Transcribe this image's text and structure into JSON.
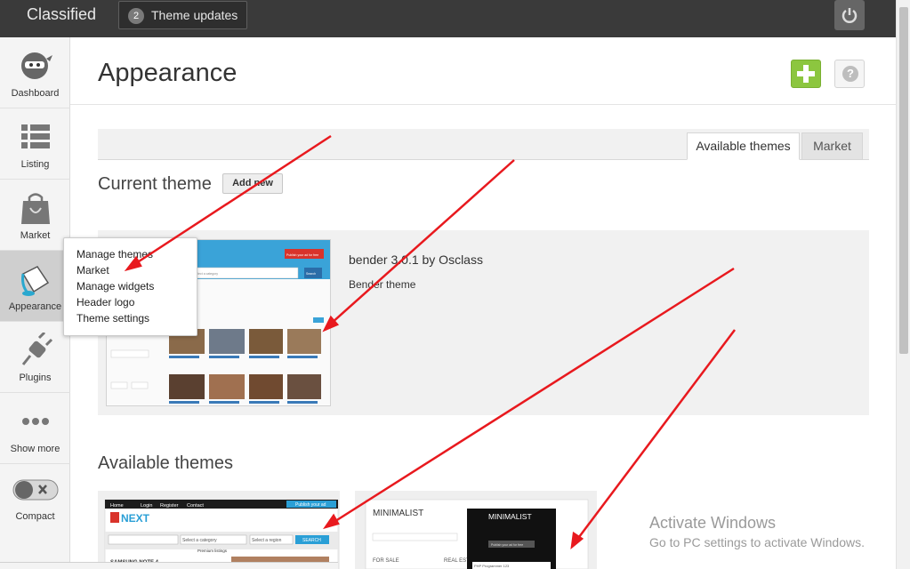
{
  "topbar": {
    "brand": "Classified",
    "updates_count": "2",
    "updates_label": "Theme updates"
  },
  "sidebar": {
    "items": [
      {
        "label": "Dashboard",
        "icon": "ninja-icon"
      },
      {
        "label": "Listing",
        "icon": "list-icon"
      },
      {
        "label": "Market",
        "icon": "shopping-bag-icon"
      },
      {
        "label": "Appearance",
        "icon": "paint-bucket-icon"
      },
      {
        "label": "Plugins",
        "icon": "plug-icon"
      },
      {
        "label": "Show more",
        "icon": "dots-icon"
      },
      {
        "label": "Compact",
        "icon": "toggle-icon"
      }
    ]
  },
  "appearance_menu": {
    "items": [
      "Manage themes",
      "Market",
      "Manage widgets",
      "Header logo",
      "Theme settings"
    ]
  },
  "main": {
    "title": "Appearance",
    "help": "?",
    "tabs": [
      {
        "label": "Available themes",
        "active": true
      },
      {
        "label": "Market",
        "active": false
      }
    ],
    "current_theme_title": "Current theme",
    "add_new_label": "Add new",
    "current_theme": {
      "name": "bender 3.0.1 by Osclass",
      "description": "Bender theme",
      "preview": {
        "publish_btn": "Publish your ad for free",
        "select_category": "Select a category",
        "search": "Search"
      }
    },
    "available_title": "Available themes",
    "available_themes": [
      {
        "preview": {
          "nav": [
            "Home",
            "Login",
            "Register",
            "Contact"
          ],
          "publish": "Publish your ad",
          "logo": "NEXT",
          "category": "Select a category",
          "region": "Select a region",
          "search": "SEARCH",
          "listing": "SAMSUNG NOTE 4",
          "premium": "Premium listings"
        }
      },
      {
        "preview": {
          "title": "MINIMALIST",
          "overlay_title": "MINIMALIST",
          "overlay_sub": "This is demo installation of Osclass 3.1.2 using Minimalist Free Responsive Theme by OsclassBase",
          "publish": "Publish your ad for free",
          "left_label": "FOR SALE",
          "right_label": "REAL ESTATE",
          "php": "PHP Programmer 123"
        }
      }
    ]
  },
  "watermark": {
    "line1": "Activate Windows",
    "line2": "Go to PC settings to activate Windows."
  },
  "colors": {
    "topbar": "#3a3a3a",
    "add_green": "#8cc63f",
    "annotation_arrow": "#e8191e",
    "next_blue": "#2a9fd6"
  }
}
